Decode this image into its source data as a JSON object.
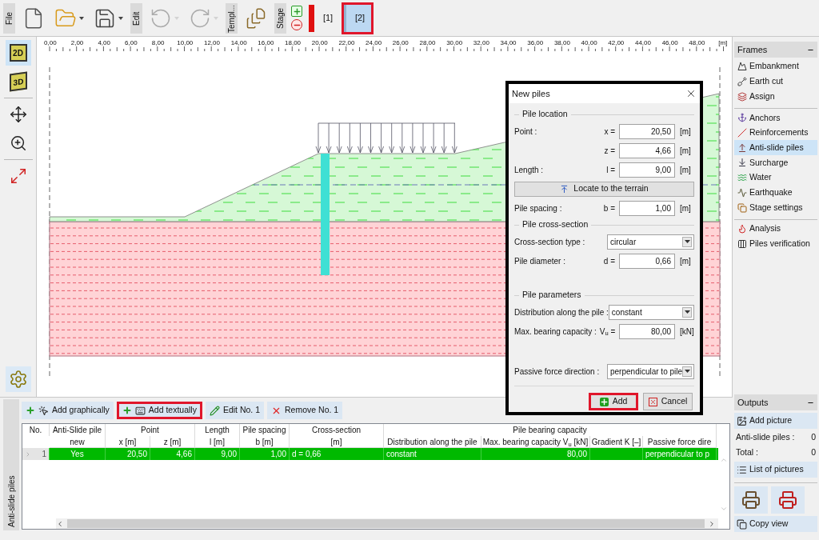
{
  "toolbar": [
    {
      "label": "File",
      "buttons": [
        {
          "kind": "new",
          "menu": false,
          "disabled": false
        },
        {
          "kind": "open",
          "menu": true,
          "disabled": false
        },
        {
          "kind": "save",
          "menu": true,
          "disabled": false
        }
      ]
    },
    {
      "label": "Edit",
      "buttons": [
        {
          "kind": "undo",
          "menu": true,
          "disabled": true
        },
        {
          "kind": "redo",
          "menu": true,
          "disabled": true
        }
      ]
    },
    {
      "label": "Templ...",
      "buttons": [
        {
          "kind": "templates",
          "menu": false,
          "disabled": false
        }
      ]
    },
    {
      "label": "Stage",
      "buttons": [
        {
          "kind": "stage-add-remove",
          "menu": false,
          "disabled": false
        }
      ]
    }
  ],
  "stages": [
    {
      "label": "[1]",
      "selected": false,
      "highlighted": false
    },
    {
      "label": "[2]",
      "selected": true,
      "highlighted": true
    }
  ],
  "tools": [
    {
      "kind": "view",
      "label": "2D",
      "selected": true
    },
    {
      "kind": "view",
      "label": "3D",
      "selected": false
    },
    {
      "kind": "move",
      "selected": false
    },
    {
      "kind": "zoom",
      "selected": false
    },
    {
      "kind": "fit",
      "selected": false
    },
    {
      "kind": "settings",
      "selected": false
    }
  ],
  "ruler": {
    "labels": [
      "0,00",
      "2,00",
      "4,00",
      "6,00",
      "8,00",
      "10,00",
      "12,00",
      "14,00",
      "16,00",
      "18,00",
      "20,00",
      "22,00",
      "24,00",
      "26,00",
      "28,00",
      "30,00",
      "32,00",
      "34,00",
      "36,00",
      "38,00",
      "40,00",
      "42,00",
      "44,00",
      "46,00",
      "48,00"
    ],
    "unit": "[m]"
  },
  "frames": {
    "title": "Frames",
    "groups": [
      {
        "items": [
          {
            "label": "Embankment",
            "selected": false
          },
          {
            "label": "Earth cut",
            "selected": false
          },
          {
            "label": "Assign",
            "selected": false
          }
        ]
      },
      {
        "items": [
          {
            "label": "Anchors",
            "selected": false
          },
          {
            "label": "Reinforcements",
            "selected": false
          },
          {
            "label": "Anti-slide piles",
            "selected": true
          },
          {
            "label": "Surcharge",
            "selected": false
          },
          {
            "label": "Water",
            "selected": false
          },
          {
            "label": "Earthquake",
            "selected": false
          },
          {
            "label": "Stage settings",
            "selected": false
          }
        ]
      },
      {
        "items": [
          {
            "label": "Analysis",
            "selected": false
          },
          {
            "label": "Piles verification",
            "selected": false
          }
        ]
      }
    ]
  },
  "dialog": {
    "title": "New piles",
    "sections": [
      {
        "title": "Pile location",
        "rows": [
          {
            "kind": "field",
            "label": "Point :",
            "symbol": "x =",
            "value": "20,50",
            "unit": "[m]"
          },
          {
            "kind": "field",
            "symbol": "z =",
            "value": "4,66",
            "unit": "[m]"
          },
          {
            "kind": "field",
            "label": "Length :",
            "symbol": "l =",
            "value": "9,00",
            "unit": "[m]"
          },
          {
            "kind": "button",
            "label": "Locate to the terrain"
          },
          {
            "kind": "field",
            "label": "Pile spacing :",
            "symbol": "b =",
            "value": "1,00",
            "unit": "[m]"
          }
        ]
      },
      {
        "title": "Pile cross-section",
        "rows": [
          {
            "kind": "select",
            "label": "Cross-section type :",
            "value": "circular"
          },
          {
            "kind": "field",
            "label": "Pile diameter :",
            "symbol": "d =",
            "value": "0,66",
            "unit": "[m]"
          }
        ]
      },
      {
        "title": "Pile parameters",
        "rows": [
          {
            "kind": "select",
            "label": "Distribution along the pile :",
            "value": "constant"
          },
          {
            "kind": "field",
            "label": "Max. bearing capacity :",
            "symbol": "V$_{u}$ =",
            "value": "80,00",
            "unit": "[kN]"
          }
        ]
      },
      {
        "rows": [
          {
            "kind": "select",
            "label": "Passive force direction :",
            "value": "perpendicular to pile"
          }
        ]
      }
    ],
    "buttons": [
      {
        "kind": "add",
        "label": "Add",
        "highlighted": true
      },
      {
        "kind": "cancel",
        "label": "Cancel",
        "highlighted": false
      }
    ]
  },
  "bottom_panel": {
    "tab_label": "Anti-slide piles",
    "buttons": [
      {
        "label": "Add graphically",
        "highlighted": false
      },
      {
        "label": "Add textually",
        "highlighted": true
      },
      {
        "label": "Edit No. 1",
        "highlighted": false
      },
      {
        "label": "Remove No. 1",
        "highlighted": false
      }
    ],
    "table": {
      "header_groups": [
        "No.",
        "Anti-Slide pile",
        "Point",
        "Length",
        "Pile spacing",
        "Cross-section",
        "Pile bearing capacity"
      ],
      "columns": [
        null,
        "new",
        "x [m]",
        "z [m]",
        "l [m]",
        "b [m]",
        "[m]",
        "Distribution along the pile",
        "Max. bearing capacity V$_{u}$ [kN]",
        "Gradient K [–]",
        "Passive force dire"
      ],
      "rows": [
        {
          "selected": true,
          "cells": [
            "1",
            "Yes",
            "20,50",
            "4,66",
            "9,00",
            "1,00",
            "d = 0,66",
            "constant",
            "80,00",
            null,
            "perpendicular to p"
          ]
        }
      ]
    }
  },
  "outputs": {
    "title": "Outputs",
    "add_picture": "Add picture",
    "counters": [
      {
        "label": "Anti-slide piles :",
        "value": "0"
      },
      {
        "label": "Total :",
        "value": "0"
      }
    ],
    "list_pictures": "List of pictures",
    "copy_view": "Copy view"
  }
}
